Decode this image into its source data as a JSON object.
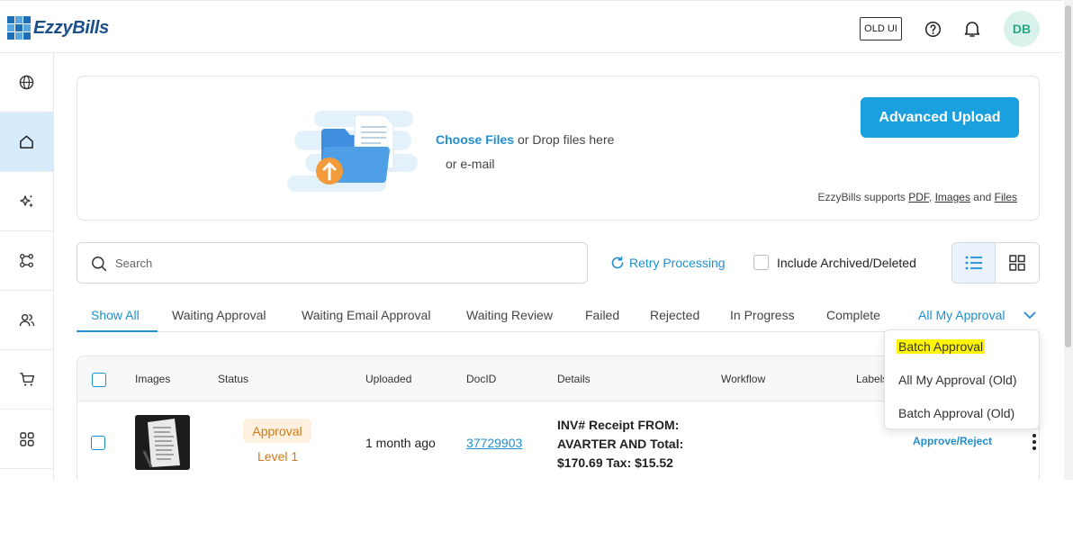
{
  "app": {
    "logo_text": "EzzyBills"
  },
  "header": {
    "old_ui_label": "OLD UI",
    "avatar_initials": "DB"
  },
  "sidebar": {
    "items": [
      "globe-icon",
      "home-icon",
      "sparkle-icon",
      "workflow-icon",
      "users-icon",
      "cart-icon",
      "apps-icon"
    ],
    "active_index": 1
  },
  "upload": {
    "choose_files": "Choose Files",
    "drop_text": " or Drop files here",
    "email_text": "or e-mail",
    "advanced_upload": "Advanced Upload",
    "supports_prefix": "EzzyBills supports ",
    "pdf": "PDF",
    "images": "Images",
    "and": " and ",
    "files": "Files"
  },
  "search": {
    "placeholder": "Search",
    "value": ""
  },
  "toolbar": {
    "retry_processing": "Retry Processing",
    "include_archived": "Include Archived/Deleted",
    "view_mode": "list"
  },
  "tabs": {
    "show_all": "Show All",
    "waiting_approval": "Waiting Approval",
    "waiting_email_approval": "Waiting Email Approval",
    "waiting_review": "Waiting Review",
    "failed": "Failed",
    "rejected": "Rejected",
    "in_progress": "In Progress",
    "complete": "Complete",
    "all_my_approval": "All My Approval"
  },
  "dropdown": {
    "batch_approval": "Batch Approval",
    "all_my_approval_old": "All My Approval (Old)",
    "batch_approval_old": "Batch Approval (Old)"
  },
  "table": {
    "columns": {
      "images": "Images",
      "status": "Status",
      "uploaded": "Uploaded",
      "docid": "DocID",
      "details": "Details",
      "workflow": "Workflow",
      "labels": "Labels"
    },
    "rows": [
      {
        "status": "Approval",
        "status_sub": "Level 1",
        "uploaded": "1 month ago",
        "docid": "37729903",
        "details": "INV# Receipt FROM: AVARTER AND Total: $170.69 Tax: $15.52",
        "action": "Approve/Reject"
      }
    ]
  },
  "colors": {
    "accent": "#1f8fd0",
    "primary_button": "#1aa0de",
    "status_orange": "#cf7a16",
    "highlight": "#fff500"
  }
}
